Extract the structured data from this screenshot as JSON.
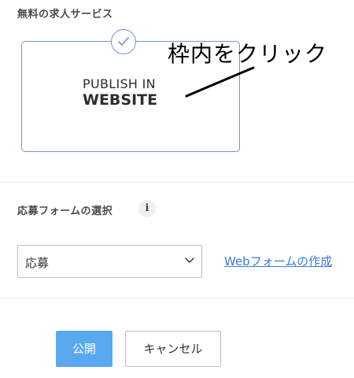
{
  "free_service": {
    "title": "無料の求人サービス",
    "card": {
      "line1": "PUBLISH IN",
      "line2": "WEBSITE",
      "selected": true
    }
  },
  "annotation": {
    "text": "枠内をクリック"
  },
  "application_form": {
    "label": "応募フォームの選択",
    "info_icon_glyph": "i",
    "select_value": "応募",
    "create_link": "Webフォームの作成"
  },
  "actions": {
    "publish_label": "公開",
    "cancel_label": "キャンセル"
  },
  "colors": {
    "card_border": "#6e95d6",
    "primary_button": "#5aa8f0",
    "link": "#3a7bd5"
  }
}
